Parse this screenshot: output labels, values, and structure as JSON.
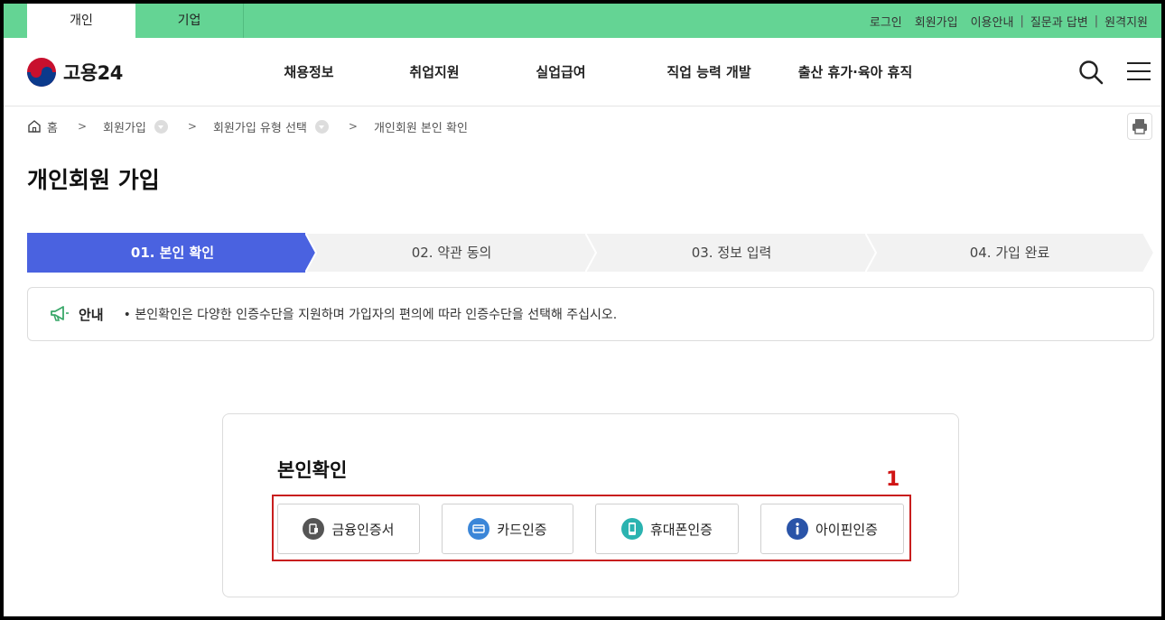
{
  "topbar": {
    "tabs": [
      {
        "label": "개인"
      },
      {
        "label": "기업"
      }
    ],
    "util": [
      "로그인",
      "회원가입",
      "이용안내",
      "질문과 답변",
      "원격지원"
    ]
  },
  "header": {
    "logo_text": "고용24",
    "nav": [
      "채용정보",
      "취업지원",
      "실업급여",
      "직업 능력 개발",
      "출산 휴가·육아 휴직"
    ],
    "icons": {
      "search": "search-icon",
      "menu": "hamburger-menu-icon"
    }
  },
  "breadcrumb": [
    "홈",
    "회원가입",
    "회원가입 유형 선택",
    "개인회원 본인 확인"
  ],
  "page_title": "개인회원 가입",
  "steps": [
    "01. 본인 확인",
    "02. 약관 동의",
    "03. 정보 입력",
    "04. 가입 완료"
  ],
  "active_step": 0,
  "colors": {
    "topbar": "#64d494",
    "step_active": "#4a62e0",
    "step_inactive": "#f2f2f2",
    "highlight": "#c81e1e"
  },
  "notice": {
    "title": "안내",
    "text": "• 본인확인은 다양한 인증수단을 지원하며 가입자의 편의에 따라 인증수단을 선택해 주십시오."
  },
  "verify": {
    "title": "본인확인",
    "marker": "1",
    "methods": [
      {
        "label": "금융인증서",
        "icon": "certificate-icon",
        "color": "#555555"
      },
      {
        "label": "카드인증",
        "icon": "card-icon",
        "color": "#3b86d8"
      },
      {
        "label": "휴대폰인증",
        "icon": "phone-icon",
        "color": "#2bb3b0"
      },
      {
        "label": "아이핀인증",
        "icon": "info-icon",
        "color": "#2a54a8"
      }
    ]
  }
}
